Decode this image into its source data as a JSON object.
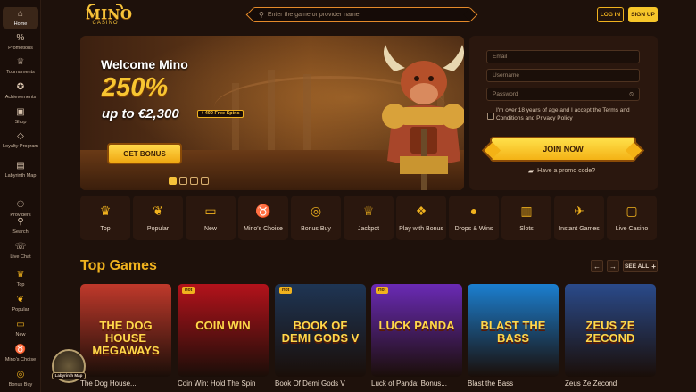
{
  "sidebar": {
    "items": [
      {
        "label": "Home",
        "icon": "home-icon",
        "glyph": "⌂"
      },
      {
        "label": "Promotions",
        "icon": "percent-badge-icon",
        "glyph": "%"
      },
      {
        "label": "Tournaments",
        "icon": "trophy-icon",
        "glyph": "♕"
      },
      {
        "label": "Achievements",
        "icon": "medal-icon",
        "glyph": "✪"
      },
      {
        "label": "Shop",
        "icon": "shopping-bag-icon",
        "glyph": "▣"
      },
      {
        "label": "Loyalty Program",
        "icon": "diamond-icon",
        "glyph": "◇"
      },
      {
        "label": "Labyrinth Map",
        "icon": "map-icon",
        "glyph": "▤"
      },
      {
        "label": "Providers",
        "icon": "providers-icon",
        "glyph": "⚇"
      },
      {
        "label": "Search",
        "icon": "search-icon",
        "glyph": "⚲"
      },
      {
        "label": "Live Chat",
        "icon": "chat-icon",
        "glyph": "☏"
      },
      {
        "label": "Top",
        "icon": "crown-icon",
        "glyph": "♛"
      },
      {
        "label": "Popular",
        "icon": "laurel-icon",
        "glyph": "❦"
      },
      {
        "label": "New",
        "icon": "new-icon",
        "glyph": "▭"
      },
      {
        "label": "Mino's Choise",
        "icon": "minotaur-icon",
        "glyph": "♉"
      },
      {
        "label": "Bonus Buy",
        "icon": "coins-icon",
        "glyph": "◎"
      }
    ]
  },
  "header": {
    "logo_top": "MINO",
    "logo_bottom": "CASINO",
    "search_placeholder": "Enter the game or provider name",
    "login_label": "LOG IN",
    "signup_label": "SIGN UP"
  },
  "hero": {
    "title": "Welcome Mino",
    "percent": "250%",
    "upto": "up to €2,300",
    "spins": "+ 400 Free Spins",
    "cta": "GET BONUS",
    "slides": 4,
    "active_slide": 1
  },
  "registration": {
    "email_placeholder": "Email",
    "username_placeholder": "Username",
    "password_placeholder": "Password",
    "terms": "I'm over 18 years of age and I accept the Terms and Conditions and Privacy Policy",
    "join_label": "JOIN NOW",
    "promo_label": "Have a promo code?"
  },
  "categories": [
    {
      "label": "Top",
      "icon": "crown-icon",
      "glyph": "♛"
    },
    {
      "label": "Popular",
      "icon": "laurel-icon",
      "glyph": "❦"
    },
    {
      "label": "New",
      "icon": "new-icon",
      "glyph": "▭"
    },
    {
      "label": "Mino's Choise",
      "icon": "minotaur-icon",
      "glyph": "♉"
    },
    {
      "label": "Bonus Buy",
      "icon": "coins-icon",
      "glyph": "◎"
    },
    {
      "label": "Jackpot",
      "icon": "trophy-icon",
      "glyph": "♕"
    },
    {
      "label": "Play with Bonus",
      "icon": "gift-icon",
      "glyph": "❖"
    },
    {
      "label": "Drops & Wins",
      "icon": "pot-icon",
      "glyph": "●"
    },
    {
      "label": "Slots",
      "icon": "slot-icon",
      "glyph": "▥"
    },
    {
      "label": "Instant Games",
      "icon": "cannon-icon",
      "glyph": "✈"
    },
    {
      "label": "Live Casino",
      "icon": "live-icon",
      "glyph": "▢"
    }
  ],
  "top_games": {
    "title": "Top Games",
    "see_all": "SEE ALL",
    "games": [
      {
        "name": "The Dog House...",
        "hot": "",
        "art": "THE DOG HOUSE MEGAWAYS",
        "bg": "#c0392b"
      },
      {
        "name": "Coin Win: Hold The Spin",
        "hot": "Hot",
        "art": "COIN WIN",
        "bg": "#b3121b"
      },
      {
        "name": "Book Of Demi Gods V",
        "hot": "Hot",
        "art": "BOOK OF DEMI GODS V",
        "bg": "#1e3554"
      },
      {
        "name": "Luck of Panda: Bonus...",
        "hot": "Hot",
        "art": "LUCK PANDA",
        "bg": "#6a2ab5"
      },
      {
        "name": "Blast the Bass",
        "hot": "",
        "art": "BLAST THE BASS",
        "bg": "#1b7fd0"
      },
      {
        "name": "Zeus Ze Zecond",
        "hot": "",
        "art": "ZEUS ZE ZECOND",
        "bg": "#2a4a8a"
      }
    ]
  },
  "labyrinth_badge": "Labyrinth Map",
  "colors": {
    "accent": "#f0b21e",
    "background": "#1e110b",
    "panel": "#2a170e"
  }
}
